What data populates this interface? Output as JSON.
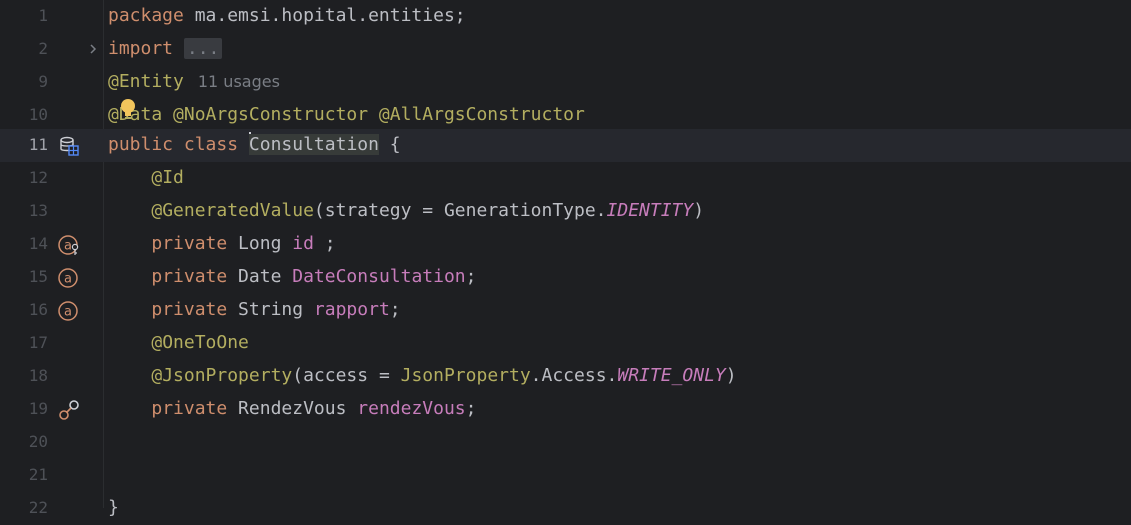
{
  "editor": {
    "colors": {
      "background": "#1e1f22",
      "current_line": "#26282e",
      "keyword": "#cf8e6d",
      "annotation": "#b3ae60",
      "field": "#c77dbb",
      "text": "#bcbec4",
      "line_number": "#4e5157"
    },
    "lines": [
      {
        "num": "1",
        "tokens": [
          "package",
          " ma.emsi.hopital.entities;"
        ]
      },
      {
        "num": "2",
        "tokens": [
          "import",
          "..."
        ],
        "gutter_icon": "fold-expand-chevron-icon"
      },
      {
        "num": "9",
        "tokens": [
          "@Entity"
        ],
        "hint": "11 usages"
      },
      {
        "num": "10",
        "tokens": [
          "@Data",
          " @NoArgsConstructor",
          " @AllArgsConstructor"
        ],
        "overlay_icon": "lightbulb-intention-icon"
      },
      {
        "num": "11",
        "tokens": [
          "public",
          " ",
          "class",
          " ",
          "Consultation",
          " {"
        ],
        "gutter_icon": "jpa-entity-database-icon",
        "current": true
      },
      {
        "num": "12",
        "tokens": [
          "    ",
          "@Id"
        ]
      },
      {
        "num": "13",
        "tokens": [
          "    ",
          "@GeneratedValue",
          "(strategy = GenerationType.",
          "IDENTITY",
          ")"
        ]
      },
      {
        "num": "14",
        "tokens": [
          "    ",
          "private",
          " Long ",
          "id",
          " ;"
        ],
        "gutter_icon": "id-attribute-key-icon"
      },
      {
        "num": "15",
        "tokens": [
          "    ",
          "private",
          " Date ",
          "DateConsultation",
          ";"
        ],
        "gutter_icon": "attribute-a-icon"
      },
      {
        "num": "16",
        "tokens": [
          "    ",
          "private",
          " String ",
          "rapport",
          ";"
        ],
        "gutter_icon": "attribute-a-icon"
      },
      {
        "num": "17",
        "tokens": [
          "    ",
          "@OneToOne"
        ]
      },
      {
        "num": "18",
        "tokens": [
          "    ",
          "@JsonProperty",
          "(access = ",
          "JsonProperty",
          ".Access.",
          "WRITE_ONLY",
          ")"
        ]
      },
      {
        "num": "19",
        "tokens": [
          "    ",
          "private",
          " RendezVous ",
          "rendezVous",
          ";"
        ],
        "gutter_icon": "relationship-link-icon"
      },
      {
        "num": "20",
        "tokens": []
      },
      {
        "num": "21",
        "tokens": []
      },
      {
        "num": "22",
        "tokens": [
          "}"
        ]
      }
    ]
  }
}
